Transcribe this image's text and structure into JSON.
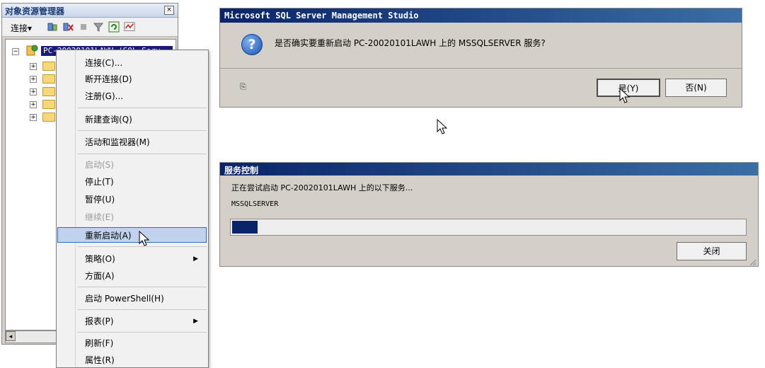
{
  "object_explorer": {
    "title": "对象资源管理器",
    "close_glyph": "×",
    "toolbar": {
      "connect_label": "连接▾"
    },
    "server_node": "PC-20020101LAWH (SQL Serv",
    "expand_glyph": "+",
    "collapse_glyph": "−",
    "scroll_left_glyph": "◂"
  },
  "context_menu": {
    "items": [
      {
        "label": "连接(C)...",
        "enabled": true
      },
      {
        "label": "断开连接(D)",
        "enabled": true
      },
      {
        "label": "注册(G)...",
        "enabled": true
      },
      {
        "label": "新建查询(Q)",
        "enabled": true
      },
      {
        "label": "活动和监视器(M)",
        "enabled": true
      },
      {
        "label": "启动(S)",
        "enabled": false
      },
      {
        "label": "停止(T)",
        "enabled": true
      },
      {
        "label": "暂停(U)",
        "enabled": true
      },
      {
        "label": "继续(E)",
        "enabled": false
      },
      {
        "label": "重新启动(A)",
        "enabled": true,
        "highlighted": true
      },
      {
        "label": "策略(O)",
        "enabled": true,
        "submenu": true
      },
      {
        "label": "方面(A)",
        "enabled": true
      },
      {
        "label": "启动 PowerShell(H)",
        "enabled": true
      },
      {
        "label": "报表(P)",
        "enabled": true,
        "submenu": true
      },
      {
        "label": "刷新(F)",
        "enabled": true
      },
      {
        "label": "属性(R)",
        "enabled": true
      }
    ],
    "submenu_glyph": "▶"
  },
  "ssms_dialog": {
    "title": "Microsoft SQL Server Management Studio",
    "icon_glyph": "?",
    "message": "是否确实要重新启动 PC-20020101LAWH 上的 MSSQLSERVER 服务?",
    "yes_label": "是(Y)",
    "no_label": "否(N)",
    "copy_glyph": "⎘"
  },
  "service_control": {
    "title": "服务控制",
    "status": "正在尝试启动 PC-20020101LAWH 上的以下服务...",
    "service_name": "MSSQLSERVER",
    "progress": 0.05,
    "close_label": "关闭"
  },
  "colors": {
    "title_bar": "#0a246a",
    "highlight": "#c1d2ee",
    "progress_fill": "#0a246a"
  }
}
